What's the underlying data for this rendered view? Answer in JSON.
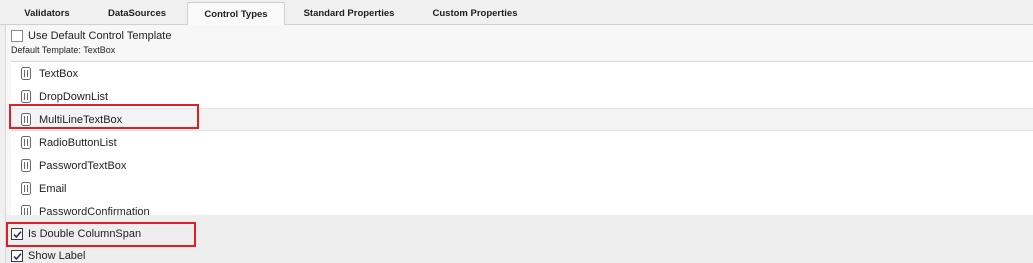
{
  "tabs": [
    {
      "label": "Validators",
      "selected": false
    },
    {
      "label": "DataSources",
      "selected": false
    },
    {
      "label": "Control Types",
      "selected": true
    },
    {
      "label": "Standard Properties",
      "selected": false
    },
    {
      "label": "Custom Properties",
      "selected": false
    }
  ],
  "use_default_template": {
    "label": "Use Default Control Template",
    "checked": false
  },
  "default_template_text": "Default Template: TextBox",
  "control_types": [
    {
      "label": "TextBox",
      "icon": "control-type-icon"
    },
    {
      "label": "DropDownList",
      "icon": "control-type-icon"
    },
    {
      "label": "MultiLineTextBox",
      "icon": "control-type-icon",
      "selected": true
    },
    {
      "label": "RadioButtonList",
      "icon": "control-type-icon"
    },
    {
      "label": "PasswordTextBox",
      "icon": "control-type-icon"
    },
    {
      "label": "Email",
      "icon": "control-type-icon"
    },
    {
      "label": "PasswordConfirmation",
      "icon": "control-type-icon"
    }
  ],
  "is_double_columnspan": {
    "label": "Is Double ColumnSpan",
    "checked": true
  },
  "show_label": {
    "label": "Show Label",
    "checked": true
  },
  "colors": {
    "highlight": "#e01e24",
    "list_background": "#ffffff",
    "selected_row": "#f3f3f3"
  }
}
